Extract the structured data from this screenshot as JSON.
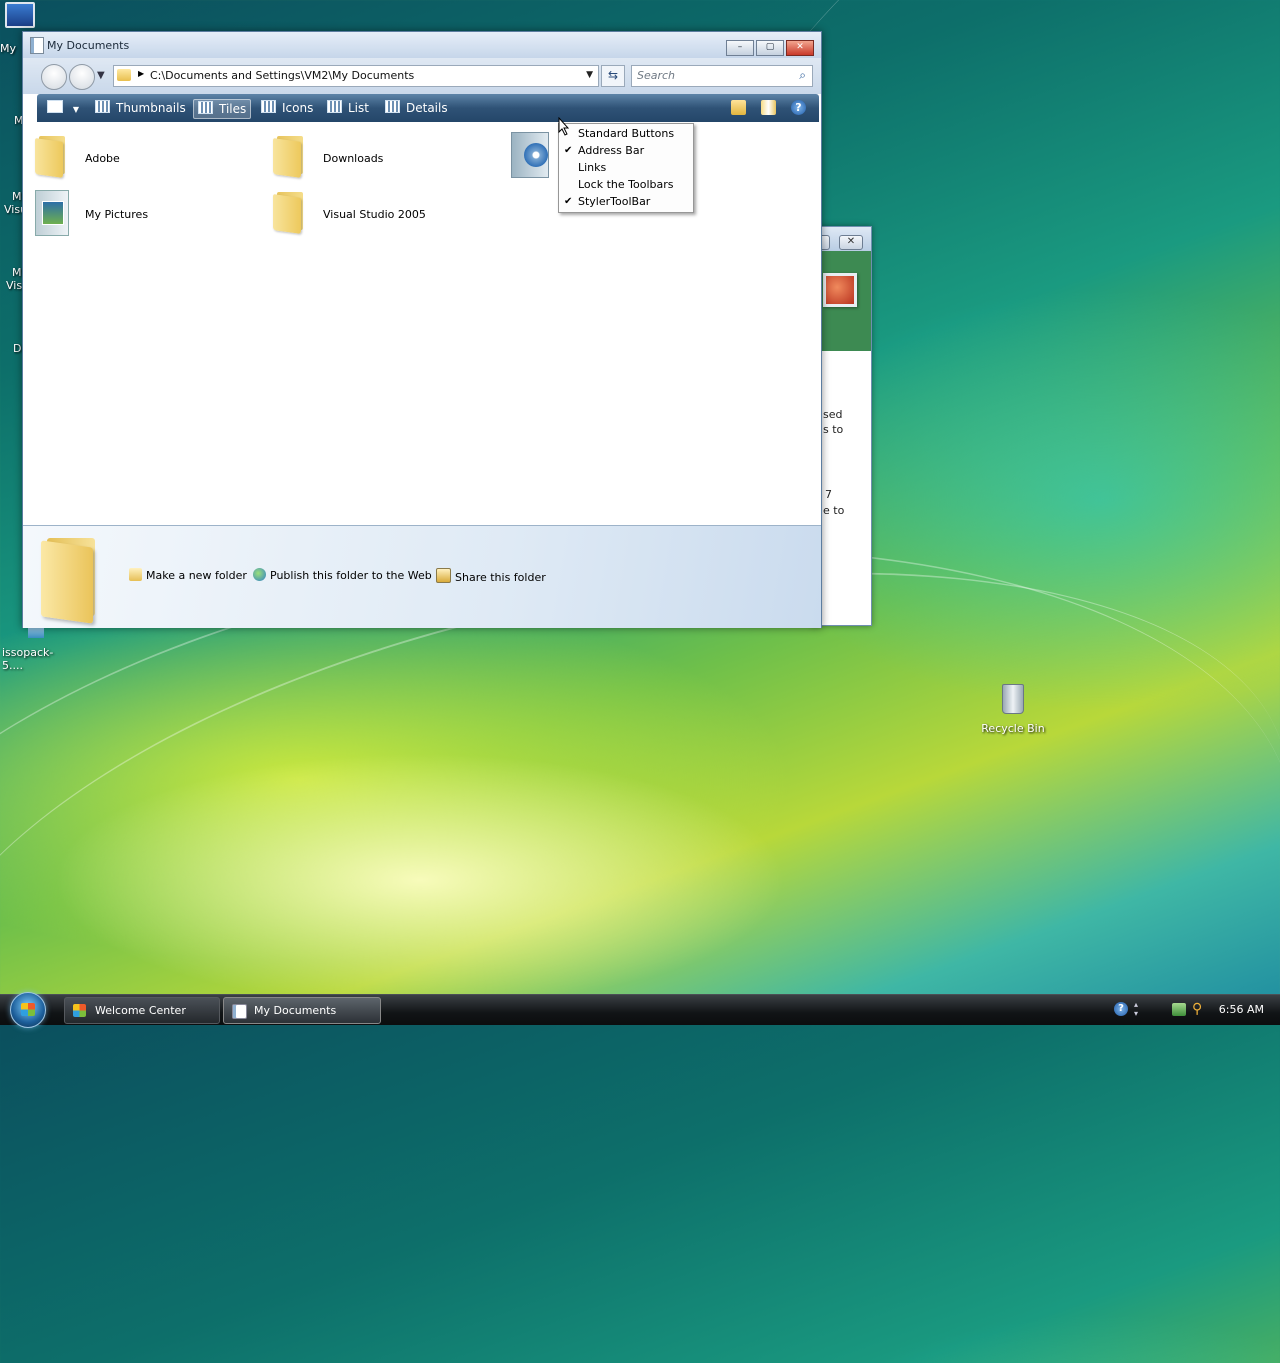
{
  "desktop": {
    "icons": [
      {
        "label": "My"
      },
      {
        "label": "issopack-5...."
      },
      {
        "label": "Recycle Bin"
      }
    ],
    "fragments": [
      "M",
      "M",
      "Visu",
      "M",
      "Vis",
      "D"
    ]
  },
  "background_window": {
    "text_lines": [
      "sed",
      "s to",
      "7",
      "e to"
    ]
  },
  "window": {
    "title": "My Documents",
    "buttons": {
      "minimize": "–",
      "maximize": "▢",
      "close": "✕"
    },
    "address": {
      "path": "C:\\Documents and Settings\\VM2\\My Documents"
    },
    "search": {
      "placeholder": "Search"
    },
    "toolbar": {
      "views": [
        {
          "label": "Thumbnails"
        },
        {
          "label": "Tiles",
          "active": true
        },
        {
          "label": "Icons"
        },
        {
          "label": "List"
        },
        {
          "label": "Details"
        }
      ]
    },
    "items": [
      {
        "name": "Adobe",
        "type": "folder"
      },
      {
        "name": "Downloads",
        "type": "folder"
      },
      {
        "name": "My Music",
        "type": "music-folder"
      },
      {
        "name": "My Pictures",
        "type": "pictures-folder"
      },
      {
        "name": "Visual Studio 2005",
        "type": "folder"
      }
    ],
    "tasks": [
      {
        "label": "Make a new folder"
      },
      {
        "label": "Publish this folder to the Web"
      },
      {
        "label": "Share this folder"
      }
    ]
  },
  "context_menu": {
    "items": [
      {
        "label": "Standard Buttons",
        "checked": false
      },
      {
        "label": "Address Bar",
        "checked": true
      },
      {
        "label": "Links",
        "checked": false
      },
      {
        "label": "Lock the Toolbars",
        "checked": false
      },
      {
        "label": "StylerToolBar",
        "checked": true
      }
    ],
    "check_glyph": "✔"
  },
  "taskbar": {
    "buttons": [
      {
        "label": "Welcome Center",
        "active": false
      },
      {
        "label": "My Documents",
        "active": true
      }
    ],
    "clock": "6:56 AM"
  },
  "colors": {
    "toolbar_dark": "#244669",
    "close_red": "#c8392a",
    "folder_yellow": "#f5dd8a"
  }
}
